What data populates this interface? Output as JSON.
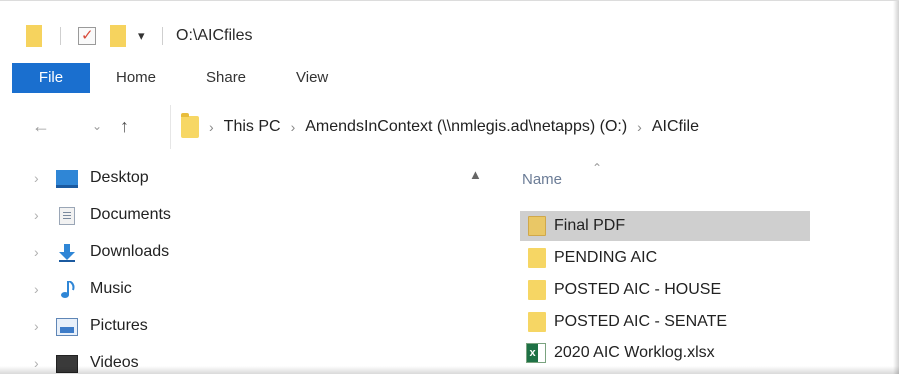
{
  "window": {
    "title": "O:\\AICfiles"
  },
  "ribbon": {
    "tabs": [
      {
        "label": "File",
        "active": true
      },
      {
        "label": "Home"
      },
      {
        "label": "Share"
      },
      {
        "label": "View"
      }
    ],
    "accent_color": "#1a6fcf"
  },
  "address": {
    "crumbs": [
      "This PC",
      "AmendsInContext (\\\\nmlegis.ad\\netapps) (O:)",
      "AICfile"
    ]
  },
  "sidebar": {
    "items": [
      {
        "label": "Desktop",
        "icon": "desktop-icon"
      },
      {
        "label": "Documents",
        "icon": "documents-icon"
      },
      {
        "label": "Downloads",
        "icon": "downloads-icon"
      },
      {
        "label": "Music",
        "icon": "music-icon"
      },
      {
        "label": "Pictures",
        "icon": "pictures-icon"
      },
      {
        "label": "Videos",
        "icon": "videos-icon"
      }
    ]
  },
  "content": {
    "column_header": "Name",
    "files": [
      {
        "label": "Final PDF",
        "type": "folder",
        "selected": true
      },
      {
        "label": "PENDING AIC",
        "type": "folder"
      },
      {
        "label": "POSTED AIC - HOUSE",
        "type": "folder"
      },
      {
        "label": "POSTED AIC - SENATE",
        "type": "folder"
      },
      {
        "label": "2020 AIC Worklog.xlsx",
        "type": "excel"
      }
    ]
  }
}
